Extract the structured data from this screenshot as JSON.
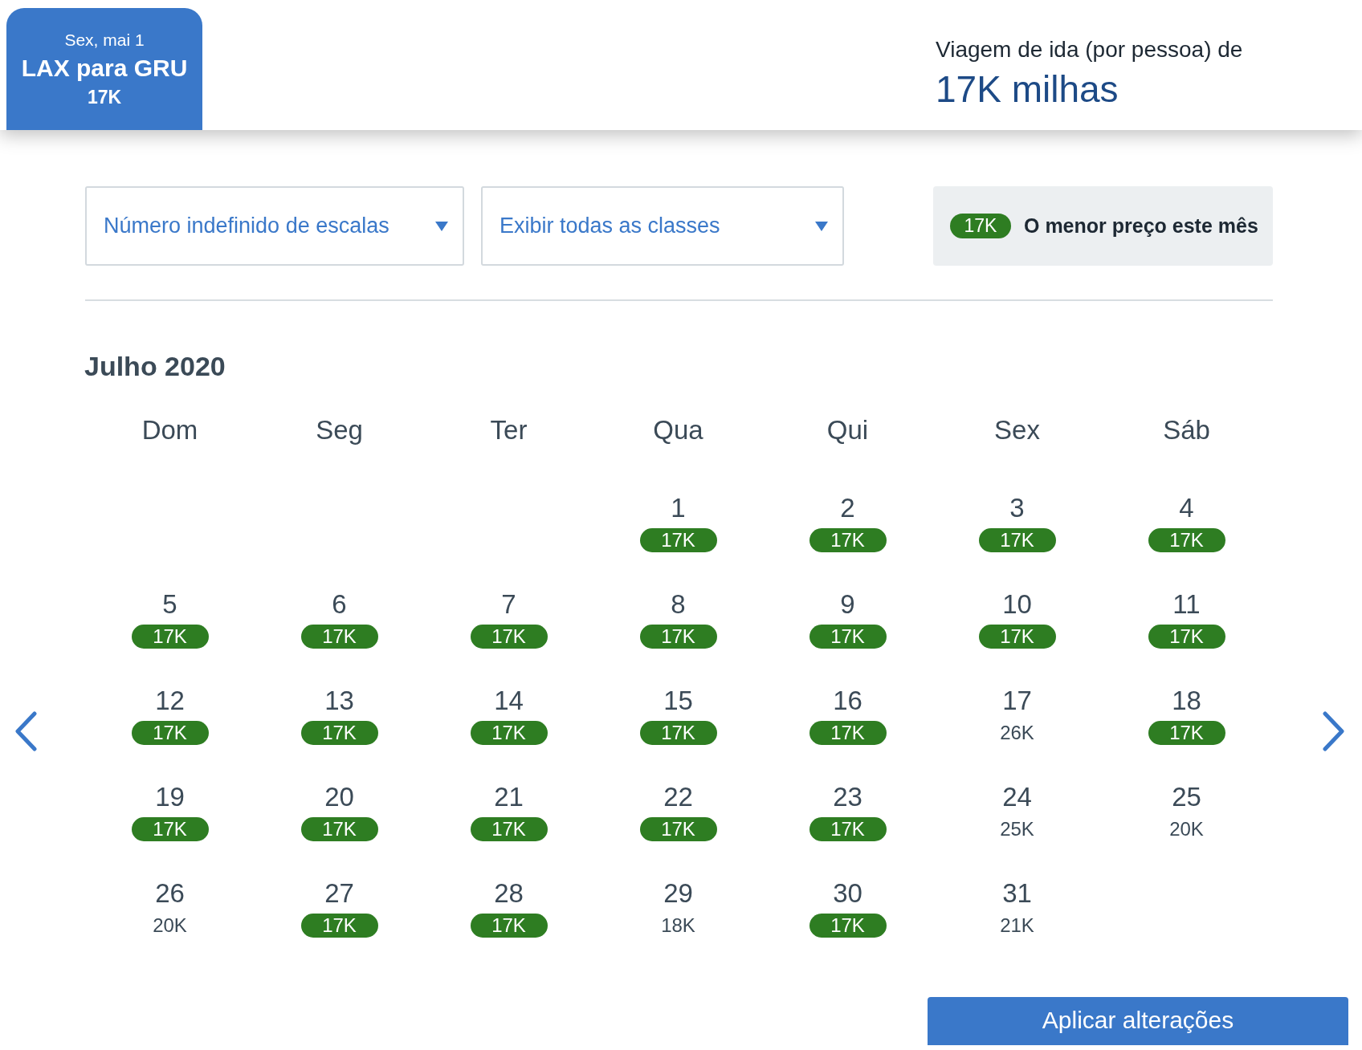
{
  "flight_tab": {
    "date": "Sex, mai 1",
    "route": "LAX para GRU",
    "price": "17K",
    "selected": true
  },
  "fare_summary": {
    "label": "Viagem de ida (por pessoa) de",
    "price": "17K milhas"
  },
  "filters": [
    {
      "value": "Número indefinido de escalas"
    },
    {
      "value": "Exibir todas as classes"
    }
  ],
  "legend": {
    "badge": "17K",
    "text": "O menor preço este mês"
  },
  "calendar": {
    "month": "Julho 2020",
    "weekdays": [
      "Dom",
      "Seg",
      "Ter",
      "Qua",
      "Qui",
      "Sex",
      "Sáb"
    ],
    "weeks": [
      [
        {
          "day": "1",
          "price": "17K",
          "lowest": true
        },
        {
          "day": "2",
          "price": "17K",
          "lowest": true
        },
        {
          "day": "3",
          "price": "17K",
          "lowest": true
        },
        {
          "day": "4",
          "price": "17K",
          "lowest": true
        }
      ],
      [
        {
          "day": "5",
          "price": "17K",
          "lowest": true
        },
        {
          "day": "6",
          "price": "17K",
          "lowest": true
        },
        {
          "day": "7",
          "price": "17K",
          "lowest": true
        },
        {
          "day": "8",
          "price": "17K",
          "lowest": true
        },
        {
          "day": "9",
          "price": "17K",
          "lowest": true
        },
        {
          "day": "10",
          "price": "17K",
          "lowest": true
        },
        {
          "day": "11",
          "price": "17K",
          "lowest": true
        }
      ],
      [
        {
          "day": "12",
          "price": "17K",
          "lowest": true
        },
        {
          "day": "13",
          "price": "17K",
          "lowest": true
        },
        {
          "day": "14",
          "price": "17K",
          "lowest": true
        },
        {
          "day": "15",
          "price": "17K",
          "lowest": true
        },
        {
          "day": "16",
          "price": "17K",
          "lowest": true
        },
        {
          "day": "17",
          "price": "26K",
          "lowest": false
        },
        {
          "day": "18",
          "price": "17K",
          "lowest": true
        }
      ],
      [
        {
          "day": "19",
          "price": "17K",
          "lowest": true
        },
        {
          "day": "20",
          "price": "17K",
          "lowest": true
        },
        {
          "day": "21",
          "price": "17K",
          "lowest": true
        },
        {
          "day": "22",
          "price": "17K",
          "lowest": true
        },
        {
          "day": "23",
          "price": "17K",
          "lowest": true
        },
        {
          "day": "24",
          "price": "25K",
          "lowest": false
        },
        {
          "day": "25",
          "price": "20K",
          "lowest": false
        }
      ],
      [
        {
          "day": "26",
          "price": "20K",
          "lowest": false
        },
        {
          "day": "27",
          "price": "17K",
          "lowest": true
        },
        {
          "day": "28",
          "price": "17K",
          "lowest": true
        },
        {
          "day": "29",
          "price": "18K",
          "lowest": false
        },
        {
          "day": "30",
          "price": "17K",
          "lowest": true
        },
        {
          "day": "31",
          "price": "21K",
          "lowest": false
        }
      ]
    ]
  },
  "apply_button": "Aplicar alterações"
}
